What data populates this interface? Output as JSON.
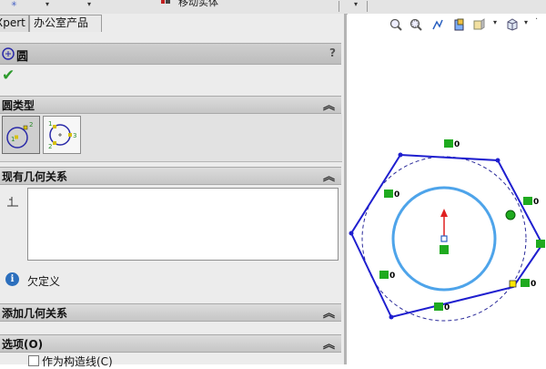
{
  "toolbar": {
    "cut_label": "移动实体"
  },
  "tabs": [
    {
      "label": "Xpert"
    },
    {
      "label": "办公室产品"
    }
  ],
  "property_manager": {
    "title": "圆",
    "help": "?",
    "confirm": "✔",
    "sections": {
      "circle_type": {
        "label": "圆类型",
        "chevron": "︽"
      },
      "existing_relations": {
        "label": "现有几何关系",
        "chevron": "︽"
      },
      "add_relations": {
        "label": "添加几何关系",
        "chevron": "︽"
      },
      "options": {
        "label": "选项(O)",
        "chevron": "︽"
      }
    },
    "circle_types": [
      {
        "name": "center-circle",
        "marks": [
          "1",
          "2"
        ]
      },
      {
        "name": "perimeter-circle",
        "marks": [
          "1",
          "2",
          "3"
        ]
      }
    ],
    "status": "欠定义",
    "info": "i",
    "construction_checkbox": {
      "label": "作为构造线(C)",
      "checked": false
    }
  },
  "sketch": {
    "relation_label": "0",
    "colors": {
      "sketch_line": "#1f1fcf",
      "selected_circle": "#4ea4ea",
      "origin_arrow": "#e02020",
      "relation_badge": "#1faa1f",
      "endpoint": "#ffe800"
    }
  },
  "icons": [
    "circle-icon",
    "ok-check-icon",
    "help-icon",
    "chevron-icon",
    "relation-icon",
    "info-icon",
    "zoom-to-fit-icon",
    "zoom-area-icon",
    "previous-view-icon",
    "section-view-icon",
    "view-orientation-icon",
    "display-style-icon"
  ]
}
